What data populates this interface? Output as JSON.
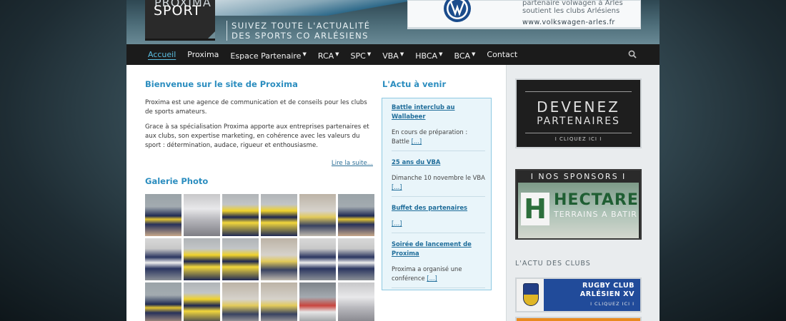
{
  "header": {
    "logo_top": "PROXIMA",
    "logo_bottom": "SPORT",
    "tagline_line1": "SUIVEZ TOUTE L'ACTUALITÉ",
    "tagline_line2": "DES SPORTS CO ARLÉSIENS",
    "ad": {
      "line1": "partenaire volwagen à Arles",
      "line2": "soutient les clubs Arlésiens",
      "url": "www.volkswagen-arles.fr"
    }
  },
  "nav": {
    "items": [
      {
        "label": "Accueil",
        "active": true,
        "dropdown": false
      },
      {
        "label": "Proxima",
        "active": false,
        "dropdown": false
      },
      {
        "label": "Espace Partenaire",
        "active": false,
        "dropdown": true
      },
      {
        "label": "RCA",
        "active": false,
        "dropdown": true
      },
      {
        "label": "SPC",
        "active": false,
        "dropdown": true
      },
      {
        "label": "VBA",
        "active": false,
        "dropdown": true
      },
      {
        "label": "HBCA",
        "active": false,
        "dropdown": true
      },
      {
        "label": "BCA",
        "active": false,
        "dropdown": true
      },
      {
        "label": "Contact",
        "active": false,
        "dropdown": false
      }
    ],
    "caret": "▼",
    "search_icon": "search-icon"
  },
  "main": {
    "welcome_title": "Bienvenue sur le site de Proxima",
    "paragraphs": [
      "Proxima est une agence de communication et de conseils pour les clubs de sports amateurs.",
      "Grace à sa spécialisation Proxima apporte aux entreprises partenaires et aux clubs, son expertise marketing, en cohérence avec les valeurs du sport : détermination, audace, rigueur et enthousiasme."
    ],
    "read_more": "Lire la suite...",
    "gallery_title": "Galerie Photo"
  },
  "events": {
    "title": "L'Actu à venir",
    "items": [
      {
        "title": "Battle interclub au Wallabeer",
        "desc": "En cours de préparation : Battle",
        "more": "[...]"
      },
      {
        "title": "25 ans du VBA",
        "desc": "Dimanche 10 novembre le VBA",
        "more": "[...]"
      },
      {
        "title": "Buffet des partenaires",
        "desc": "",
        "more": "[...]"
      },
      {
        "title": "Soirée de lancement de Proxima",
        "desc": "Proxima a organisé une conférence",
        "more": "[...]"
      }
    ]
  },
  "sidebar": {
    "devenez": {
      "line1": "DEVENEZ",
      "line2": "PARTENAIRES",
      "line3": "I CLIQUEZ ICI I"
    },
    "sponsors": {
      "label": "I NOS SPONSORS I",
      "brand_letter": "H",
      "brand": "HECTARE",
      "sub": "TERRAINS A BATIR"
    },
    "actu_clubs": "L'ACTU DES CLUBS",
    "rugby": {
      "line1": "RUGBY CLUB",
      "line2": "ARLÉSIEN XV",
      "line3": "I CLIQUEZ ICI I"
    }
  },
  "colors": {
    "accent": "#2b8dbf",
    "nav_bg": "#1b1b1b",
    "nav_active": "#5bbde0"
  }
}
